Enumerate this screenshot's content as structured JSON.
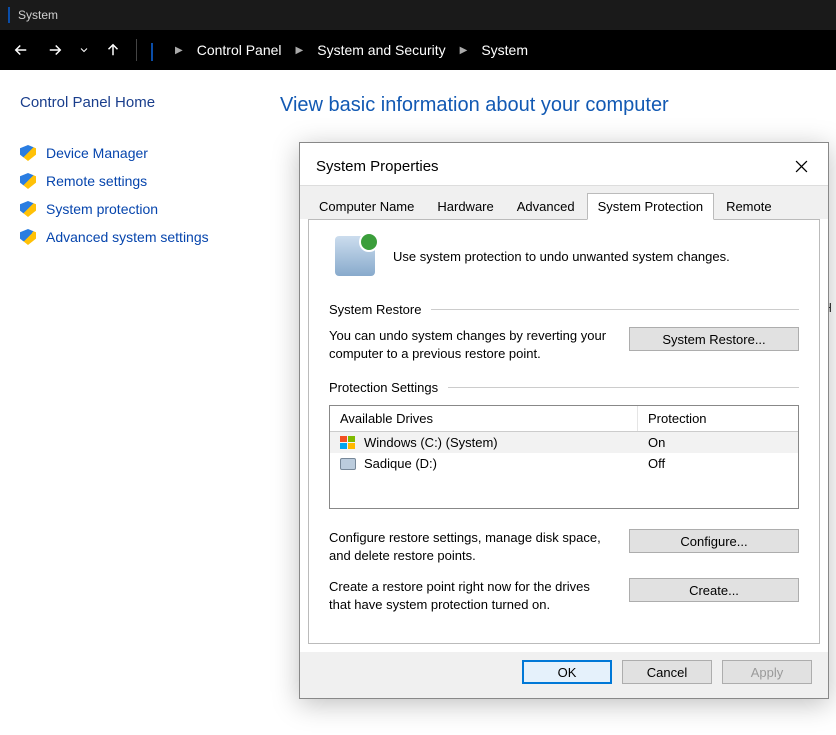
{
  "titlebar": {
    "title": "System"
  },
  "breadcrumb": {
    "items": [
      "Control Panel",
      "System and Security",
      "System"
    ]
  },
  "sidebar": {
    "home": "Control Panel Home",
    "links": [
      {
        "label": "Device Manager"
      },
      {
        "label": "Remote settings"
      },
      {
        "label": "System protection"
      },
      {
        "label": "Advanced system settings"
      }
    ]
  },
  "main": {
    "heading": "View basic information about your computer",
    "behind_fragment": "GH"
  },
  "dialog": {
    "title": "System Properties",
    "tabs": [
      "Computer Name",
      "Hardware",
      "Advanced",
      "System Protection",
      "Remote"
    ],
    "active_tab": "System Protection",
    "intro": "Use system protection to undo unwanted system changes.",
    "restore": {
      "heading": "System Restore",
      "text": "You can undo system changes by reverting your computer to a previous restore point.",
      "button": "System Restore..."
    },
    "protection": {
      "heading": "Protection Settings",
      "col_drive": "Available Drives",
      "col_prot": "Protection",
      "drives": [
        {
          "name": "Windows (C:) (System)",
          "status": "On",
          "type": "windows"
        },
        {
          "name": "Sadique (D:)",
          "status": "Off",
          "type": "hdd"
        }
      ],
      "configure_text": "Configure restore settings, manage disk space, and delete restore points.",
      "configure_button": "Configure...",
      "create_text": "Create a restore point right now for the drives that have system protection turned on.",
      "create_button": "Create..."
    },
    "buttons": {
      "ok": "OK",
      "cancel": "Cancel",
      "apply": "Apply"
    }
  }
}
